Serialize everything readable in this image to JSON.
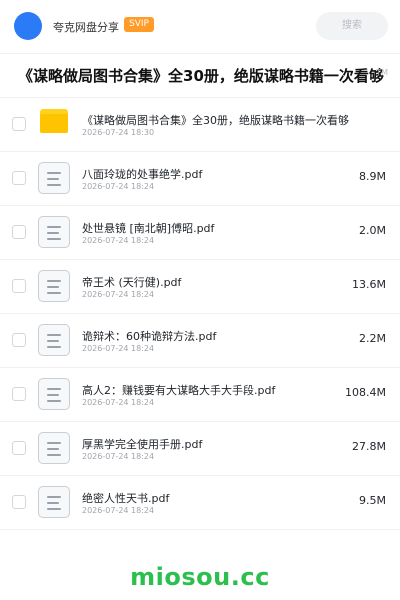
{
  "header": {
    "sharer_name": "夸克网盘分享",
    "badge": "SVIP",
    "search_placeholder": "搜索",
    "avatar_color": "#2c7bf6",
    "badge_color": "#ff9b26"
  },
  "page_title": "《谋略做局图书合集》全30册，绝版谋略书籍一次看够",
  "title_overflow_hint": "TM",
  "files": [
    {
      "name": "《谋略做局图书合集》全30册，绝版谋略书籍一次看够",
      "date": "2026-07-24 18:30",
      "size": "",
      "icon": "folder-icon",
      "is_folder": true
    },
    {
      "name": "八面玲珑的处事绝学.pdf",
      "date": "2026-07-24 18:24",
      "size": "8.9M",
      "icon": "pdf-file-icon",
      "is_folder": false
    },
    {
      "name": "处世悬镜 [南北朝]傅昭.pdf",
      "date": "2026-07-24 18:24",
      "size": "2.0M",
      "icon": "pdf-file-icon",
      "is_folder": false
    },
    {
      "name": "帝王术 (天行健).pdf",
      "date": "2026-07-24 18:24",
      "size": "13.6M",
      "icon": "pdf-file-icon",
      "is_folder": false
    },
    {
      "name": "诡辩术：60种诡辩方法.pdf",
      "date": "2026-07-24 18:24",
      "size": "2.2M",
      "icon": "pdf-file-icon",
      "is_folder": false
    },
    {
      "name": "高人2：赚钱要有大谋略大手大手段.pdf",
      "date": "2026-07-24 18:24",
      "size": "108.4M",
      "icon": "pdf-file-icon",
      "is_folder": false
    },
    {
      "name": "厚黑学完全使用手册.pdf",
      "date": "2026-07-24 18:24",
      "size": "27.8M",
      "icon": "pdf-file-icon",
      "is_folder": false
    },
    {
      "name": "绝密人性天书.pdf",
      "date": "2026-07-24 18:24",
      "size": "9.5M",
      "icon": "pdf-file-icon",
      "is_folder": false
    }
  ],
  "watermark": "miosou.cc",
  "watermark_color": "#2bbf4e"
}
